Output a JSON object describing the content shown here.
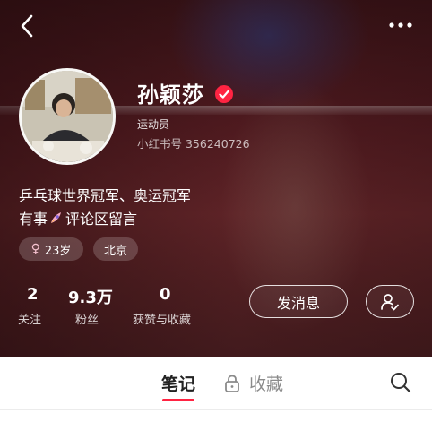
{
  "profile": {
    "name": "孙颖莎",
    "role": "运动员",
    "red_id": "小红书号 356240726",
    "bio_line1": "乒乓球世界冠军、奥运冠军",
    "bio_line2_before": "有事",
    "bio_line2_after": "评论区留言",
    "tags": {
      "gender_age": "23岁",
      "city": "北京"
    }
  },
  "stats": [
    {
      "value": "2",
      "label": "关注"
    },
    {
      "value": "9.3万",
      "label": "粉丝"
    },
    {
      "value": "0",
      "label": "获赞与收藏"
    }
  ],
  "actions": {
    "message_label": "发消息"
  },
  "tabs": [
    {
      "label": "笔记",
      "active": true
    },
    {
      "label": "收藏",
      "active": false
    }
  ],
  "icons": [
    "back-icon",
    "more-icon",
    "verified-icon",
    "female-icon",
    "user-check-icon",
    "lock-icon",
    "search-icon"
  ],
  "colors": {
    "accent": "#ff2442",
    "hero_bg": "#5a1e24"
  }
}
